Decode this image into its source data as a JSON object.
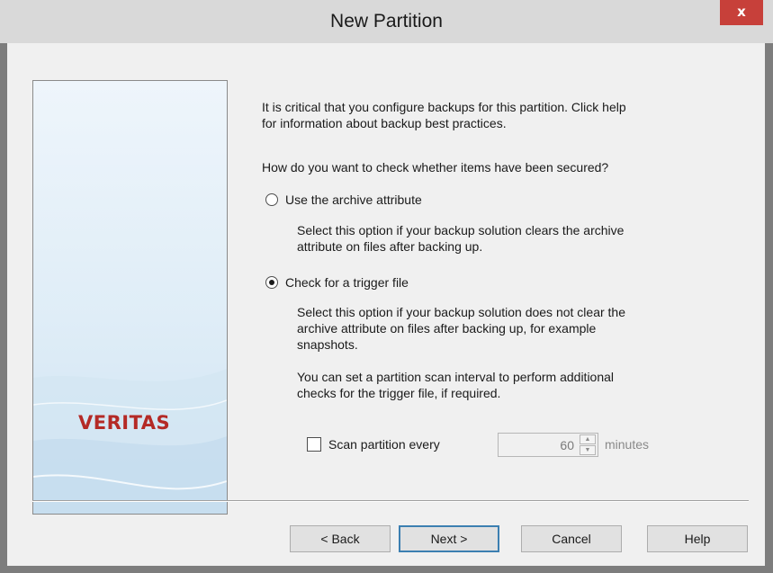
{
  "window": {
    "title": "New Partition",
    "close_glyph": "x"
  },
  "brand": {
    "logo_text": "VERITAS",
    "logo_color": "#b42a26"
  },
  "intro": {
    "line1": "It is critical that you configure backups for this partition. Click help",
    "line2": "for information about backup best practices."
  },
  "question": "How do you want to check whether items have been secured?",
  "options": [
    {
      "label": "Use the archive attribute",
      "selected": false,
      "description": [
        "Select this option if your backup solution clears the archive",
        "attribute on files after backing up."
      ]
    },
    {
      "label": "Check for a trigger file",
      "selected": true,
      "description": [
        "Select this option if your backup solution does not clear the",
        "archive attribute on files after backing up, for example",
        "snapshots."
      ]
    }
  ],
  "scan_note": [
    "You can set a partition scan interval to perform additional",
    "checks for the trigger file, if required."
  ],
  "scan": {
    "checkbox_label": "Scan partition every",
    "checked": false,
    "interval_value": "60",
    "unit_label": "minutes",
    "enabled": false
  },
  "buttons": {
    "back": "< Back",
    "next": "Next >",
    "cancel": "Cancel",
    "help": "Help"
  },
  "icons": {
    "close": "close-icon",
    "spin_up": "chevron-up-icon",
    "spin_down": "chevron-down-icon"
  }
}
